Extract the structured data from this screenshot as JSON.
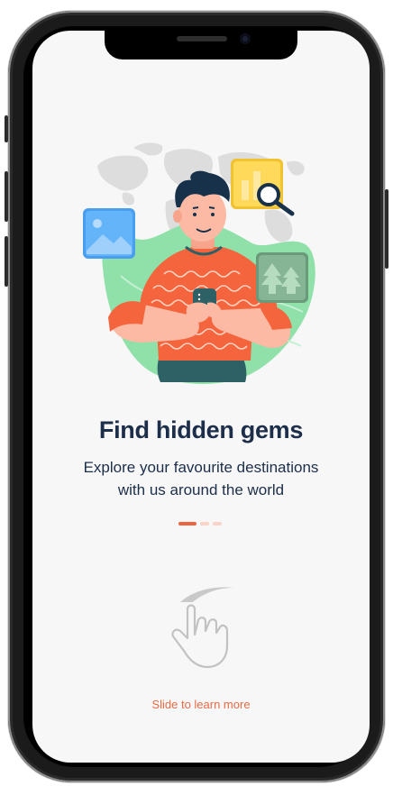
{
  "onboarding": {
    "title": "Find hidden gems",
    "subtitle_line1": "Explore your favourite destinations",
    "subtitle_line2": "with us around the world",
    "swipe_hint": "Slide to learn more",
    "page_indicator": {
      "current": 1,
      "total": 3
    }
  },
  "colors": {
    "accent": "#ee6440",
    "title_navy": "#1c2e4a",
    "indicator_inactive": "#fbd4c9",
    "blob_green": "#8fe0a9",
    "shirt_orange": "#f4653e"
  },
  "icons": [
    "image-icon",
    "search-chart-icon",
    "forest-icon",
    "swipe-hand-icon"
  ]
}
